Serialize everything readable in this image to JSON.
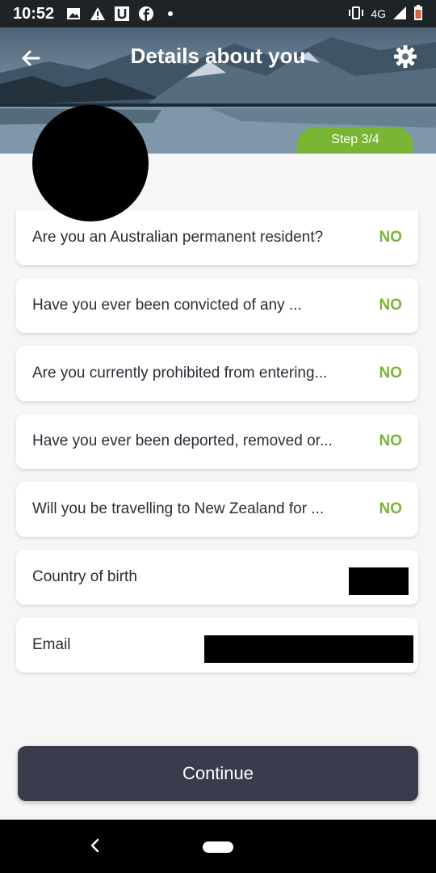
{
  "status_bar": {
    "time": "10:52",
    "left_icons": [
      "image-icon",
      "warning-icon",
      "u-app-icon",
      "facebook-icon",
      "dot-icon"
    ],
    "network": "4G",
    "right_icons": [
      "vibrate-icon",
      "signal-icon",
      "battery-icon"
    ]
  },
  "header": {
    "title": "Details about you",
    "step": "Step 3/4",
    "back_icon": "arrow-left-icon",
    "settings_icon": "gear-icon"
  },
  "questions": [
    {
      "label": "Are you an Australian permanent resident?",
      "value": "NO"
    },
    {
      "label": "Have you ever been convicted of any ...",
      "value": "NO"
    },
    {
      "label": "Are you currently prohibited from entering...",
      "value": "NO"
    },
    {
      "label": "Have you ever been deported, removed or...",
      "value": "NO"
    },
    {
      "label": "Will you be travelling to New Zealand for ...",
      "value": "NO"
    }
  ],
  "fields": [
    {
      "label": "Country of birth"
    },
    {
      "label": "Email"
    }
  ],
  "continue_label": "Continue",
  "colors": {
    "accent_green": "#7ab534",
    "button_dark": "#3a3b4d",
    "text_dark": "#2b2d38"
  }
}
